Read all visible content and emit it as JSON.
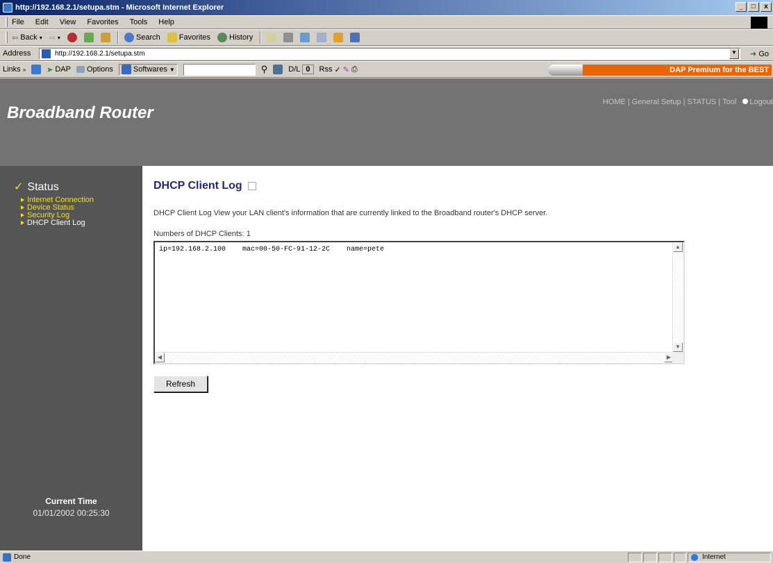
{
  "window": {
    "title": "http://192.168.2.1/setupa.stm - Microsoft Internet Explorer",
    "min": "_",
    "max": "□",
    "close": "x"
  },
  "menu": [
    "File",
    "Edit",
    "View",
    "Favorites",
    "Tools",
    "Help"
  ],
  "toolbar": {
    "back": "Back",
    "search": "Search",
    "favorites": "Favorites",
    "history": "History"
  },
  "address": {
    "label": "Address",
    "url": "http://192.168.2.1/setupa.stm",
    "go": "Go"
  },
  "links": {
    "label": "Links",
    "dap": "DAP",
    "options": "Options",
    "softwares": "Softwares",
    "dl": "D/L",
    "dl_count": "0",
    "rss": "Rss",
    "banner": "DAP Premium for the BEST"
  },
  "header": {
    "brand": "Broadband Router",
    "nav": [
      "HOME",
      "General Setup",
      "STATUS",
      "Tool",
      "Logout"
    ]
  },
  "sidebar": {
    "section": "Status",
    "items": [
      {
        "label": "Internet Connection",
        "active": false
      },
      {
        "label": "Device Status",
        "active": false
      },
      {
        "label": "Security Log",
        "active": false
      },
      {
        "label": "DHCP Client Log",
        "active": true
      }
    ],
    "time_label": "Current Time",
    "time_value": "01/01/2002 00:25:30"
  },
  "main": {
    "title": "DHCP Client Log",
    "description": "DHCP Client Log View your LAN client's information that are currently linked to the Broadband router's DHCP server.",
    "count_label": "Numbers of DHCP Clients:",
    "count_value": "1",
    "log_text": "ip=192.168.2.100    mac=00-50-FC-91-12-2C    name=pete",
    "refresh": "Refresh"
  },
  "statusbar": {
    "status": "Done",
    "zone": "Internet"
  },
  "colors": {
    "header_bg": "#737373",
    "sidebar_bg": "#555555",
    "title_color": "#25296e",
    "accent_yellow": "#f0e020",
    "banner_orange": "#e8650a"
  }
}
